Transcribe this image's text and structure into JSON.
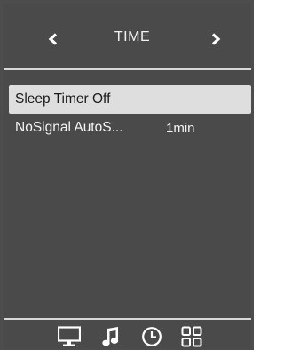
{
  "header": {
    "title": "TIME",
    "prev_icon": "chevron-left-icon",
    "next_icon": "chevron-right-icon"
  },
  "menu": {
    "items": [
      {
        "label": "Sleep Timer Off",
        "value": "",
        "selected": true
      },
      {
        "label": "NoSignal AutoS...",
        "value": "1min",
        "selected": false
      }
    ]
  },
  "nav": {
    "items": [
      {
        "icon": "monitor-icon",
        "name": "picture"
      },
      {
        "icon": "music-note-icon",
        "name": "sound"
      },
      {
        "icon": "clock-icon",
        "name": "time"
      },
      {
        "icon": "apps-grid-icon",
        "name": "apps"
      }
    ]
  },
  "colors": {
    "background": "#4a4a4a",
    "highlight": "#dedede",
    "text": "#f4f4f4",
    "selected_text": "#1a1a1a",
    "divider": "#d8d8d8"
  }
}
